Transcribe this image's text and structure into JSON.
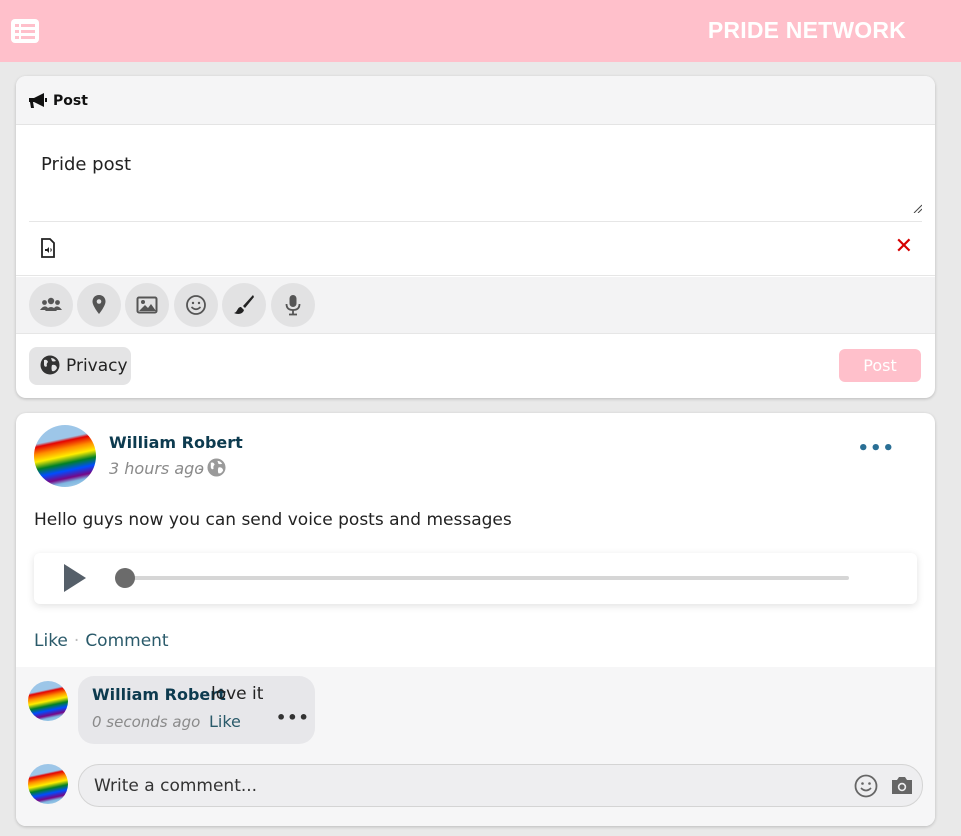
{
  "app": {
    "brand": "PRIDE NETWORK"
  },
  "composer": {
    "header_label": "Post",
    "text_value": "Pride post",
    "privacy_label": "Privacy",
    "post_button": "Post",
    "remove_glyph": "✕",
    "tools": [
      "friends-icon",
      "location-icon",
      "image-icon",
      "emoji-icon",
      "brush-icon",
      "microphone-icon"
    ]
  },
  "post": {
    "author": "William Robert",
    "time": "3 hours ago",
    "separator": "-",
    "more": "•••",
    "text": "Hello guys now you can send voice posts and messages",
    "audio_progress": 0,
    "like_label": "Like",
    "comment_label": "Comment",
    "action_separator": "·"
  },
  "comment": {
    "author": "William Robert",
    "text": "love it",
    "time": "0 seconds ago",
    "like_label": "Like",
    "more": "•••"
  },
  "write_comment": {
    "placeholder": "Write a comment..."
  },
  "colors": {
    "brand_pink": "#ffc0cb",
    "author_name": "#0d3b4f",
    "delete_red": "#d60000"
  }
}
